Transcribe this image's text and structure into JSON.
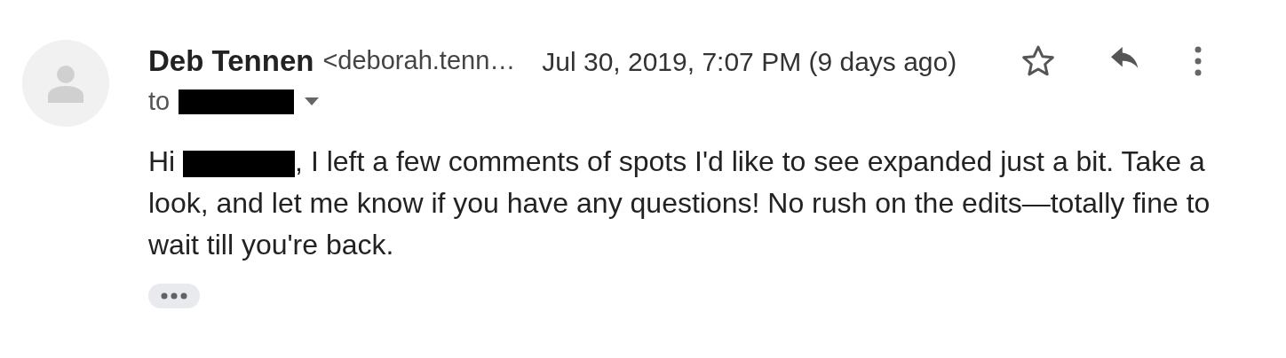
{
  "message": {
    "sender_name": "Deb Tennen",
    "sender_email": "<deborah.tenn…",
    "date": "Jul 30, 2019, 7:07 PM (9 days ago)",
    "starred": false,
    "recipient": {
      "label": "to",
      "redacted": true
    },
    "body": [
      {
        "kind": "text",
        "text": "Hi "
      },
      {
        "kind": "redacted"
      },
      {
        "kind": "text",
        "text": ", I left a few comments of spots I'd like to see expanded just a bit. Take a look, and let me know if you have any questions! No rush on the edits—totally fine to wait till you're back."
      }
    ]
  }
}
